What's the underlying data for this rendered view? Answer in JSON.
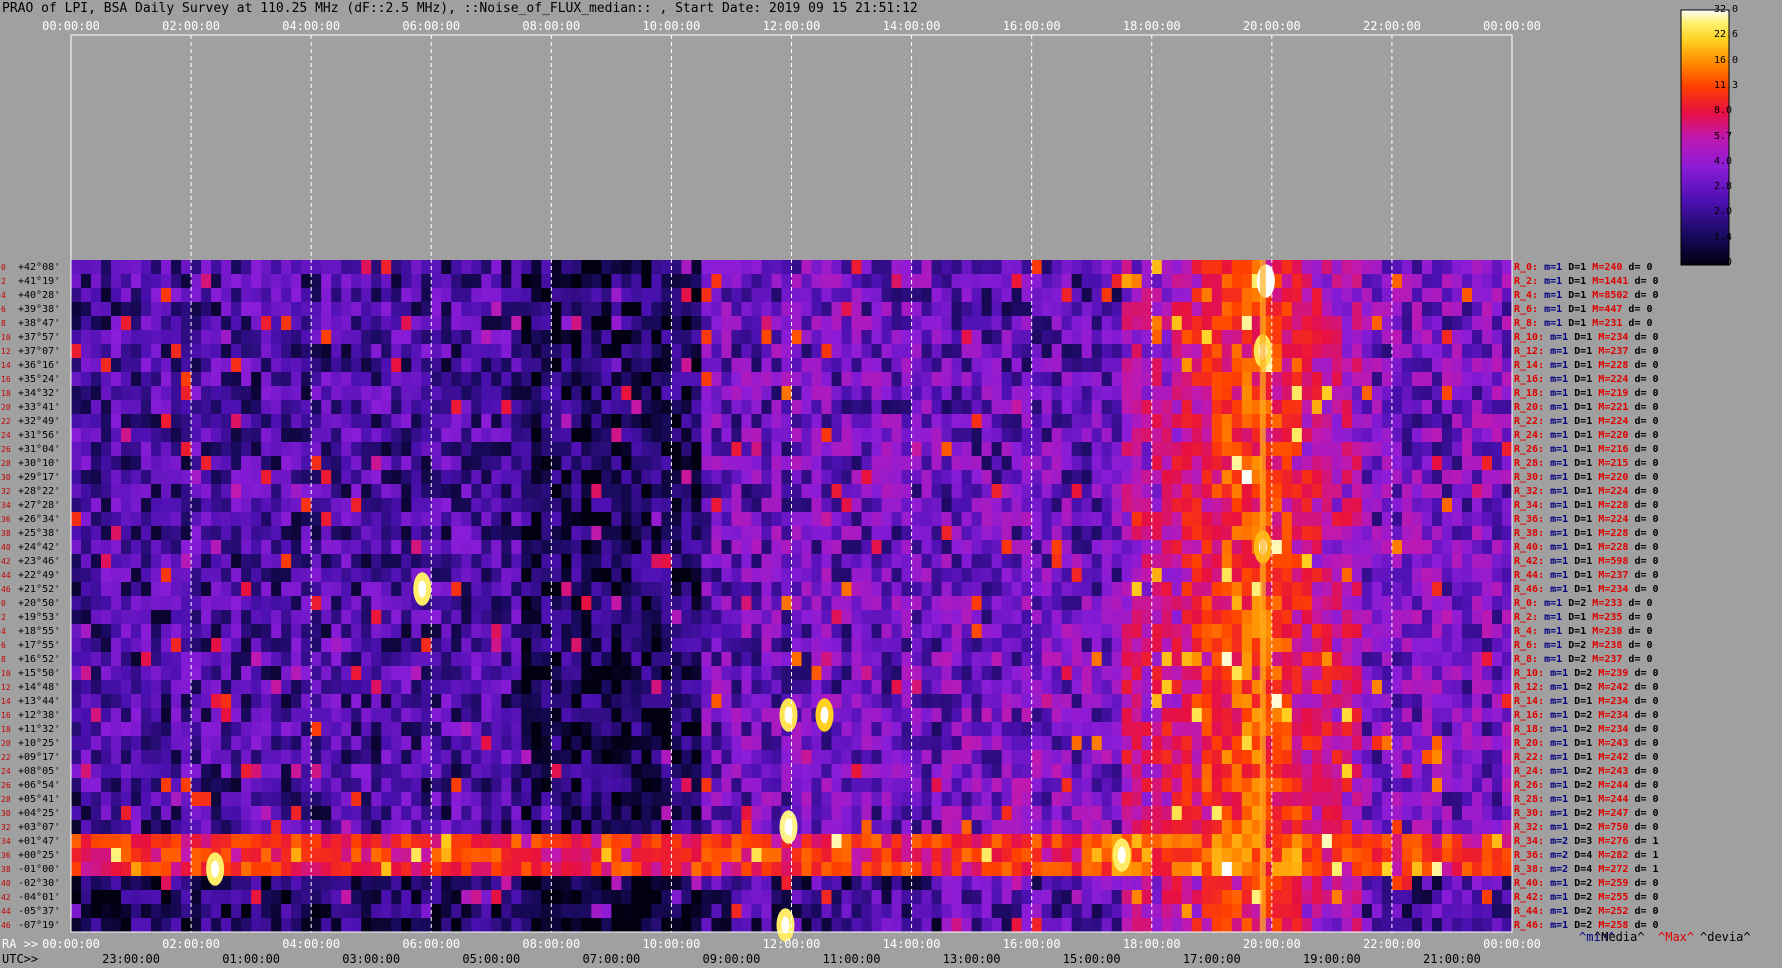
{
  "title": "PRAO of LPI, BSA Daily Survey at 110.25 MHz (dF::2.5 MHz), ::Noise_of_FLUX_median:: , Start Date: 2019 09 15 21:51:12",
  "axis": {
    "ra_prefix": "RA >>",
    "utc_prefix": "UTC>>",
    "top_ticks": [
      "00:00:00",
      "02:00:00",
      "04:00:00",
      "06:00:00",
      "08:00:00",
      "10:00:00",
      "12:00:00",
      "14:00:00",
      "16:00:00",
      "18:00:00",
      "20:00:00",
      "22:00:00",
      "00:00:00"
    ],
    "ra_ticks": [
      "00:00:00",
      "02:00:00",
      "04:00:00",
      "06:00:00",
      "08:00:00",
      "10:00:00",
      "12:00:00",
      "14:00:00",
      "16:00:00",
      "18:00:00",
      "20:00:00",
      "22:00:00",
      "00:00:00"
    ],
    "utc_ticks": [
      "23:00:00",
      "01:00:00",
      "03:00:00",
      "05:00:00",
      "07:00:00",
      "09:00:00",
      "11:00:00",
      "13:00:00",
      "15:00:00",
      "17:00:00",
      "19:00:00",
      "21:00:00"
    ]
  },
  "declinations": [
    "+42°08'",
    "+41°19'",
    "+40°28'",
    "+39°38'",
    "+38°47'",
    "+37°57'",
    "+37°07'",
    "+36°16'",
    "+35°24'",
    "+34°32'",
    "+33°41'",
    "+32°49'",
    "+31°56'",
    "+31°04'",
    "+30°10'",
    "+29°17'",
    "+28°22'",
    "+27°28'",
    "+26°34'",
    "+25°38'",
    "+24°42'",
    "+23°46'",
    "+22°49'",
    "+21°52'",
    "+20°50'",
    "+19°53'",
    "+18°55'",
    "+17°55'",
    "+16°52'",
    "+15°50'",
    "+14°48'",
    "+13°44'",
    "+12°38'",
    "+11°32'",
    "+10°25'",
    "+09°17'",
    "+08°05'",
    "+06°54'",
    "+05°41'",
    "+04°25'",
    "+03°07'",
    "+01°47'",
    "+00°25'",
    "-01°00'",
    "-02°30'",
    "-04°01'",
    "-05°37'",
    "-07°19'"
  ],
  "row_indices": [
    "0",
    "2",
    "4",
    "6",
    "8",
    "10",
    "12",
    "14",
    "16",
    "18",
    "20",
    "22",
    "24",
    "26",
    "28",
    "30",
    "32",
    "34",
    "36",
    "38",
    "40",
    "42",
    "44",
    "46",
    "0",
    "2",
    "4",
    "6",
    "8",
    "10",
    "12",
    "14",
    "16",
    "18",
    "20",
    "22",
    "24",
    "26",
    "28",
    "30",
    "32",
    "34",
    "36",
    "38",
    "40",
    "42",
    "44",
    "46"
  ],
  "stats": [
    {
      "r": "R_0:",
      "m": "m=1",
      "D": "D=1",
      "M": "M=240",
      "d": "d= 0"
    },
    {
      "r": "R_2:",
      "m": "m=1",
      "D": "D=1",
      "M": "M=1441",
      "d": "d= 0"
    },
    {
      "r": "R_4:",
      "m": "m=1",
      "D": "D=1",
      "M": "M=8502",
      "d": "d= 0"
    },
    {
      "r": "R_6:",
      "m": "m=1",
      "D": "D=1",
      "M": "M=447",
      "d": "d= 0"
    },
    {
      "r": "R_8:",
      "m": "m=1",
      "D": "D=1",
      "M": "M=231",
      "d": "d= 0"
    },
    {
      "r": "R_10:",
      "m": "m=1",
      "D": "D=1",
      "M": "M=234",
      "d": "d= 0"
    },
    {
      "r": "R_12:",
      "m": "m=1",
      "D": "D=1",
      "M": "M=237",
      "d": "d= 0"
    },
    {
      "r": "R_14:",
      "m": "m=1",
      "D": "D=1",
      "M": "M=228",
      "d": "d= 0"
    },
    {
      "r": "R_16:",
      "m": "m=1",
      "D": "D=1",
      "M": "M=224",
      "d": "d= 0"
    },
    {
      "r": "R_18:",
      "m": "m=1",
      "D": "D=1",
      "M": "M=219",
      "d": "d= 0"
    },
    {
      "r": "R_20:",
      "m": "m=1",
      "D": "D=1",
      "M": "M=221",
      "d": "d= 0"
    },
    {
      "r": "R_22:",
      "m": "m=1",
      "D": "D=1",
      "M": "M=224",
      "d": "d= 0"
    },
    {
      "r": "R_24:",
      "m": "m=1",
      "D": "D=1",
      "M": "M=220",
      "d": "d= 0"
    },
    {
      "r": "R_26:",
      "m": "m=1",
      "D": "D=1",
      "M": "M=216",
      "d": "d= 0"
    },
    {
      "r": "R_28:",
      "m": "m=1",
      "D": "D=1",
      "M": "M=215",
      "d": "d= 0"
    },
    {
      "r": "R_30:",
      "m": "m=1",
      "D": "D=1",
      "M": "M=220",
      "d": "d= 0"
    },
    {
      "r": "R_32:",
      "m": "m=1",
      "D": "D=1",
      "M": "M=224",
      "d": "d= 0"
    },
    {
      "r": "R_34:",
      "m": "m=1",
      "D": "D=1",
      "M": "M=228",
      "d": "d= 0"
    },
    {
      "r": "R_36:",
      "m": "m=1",
      "D": "D=1",
      "M": "M=224",
      "d": "d= 0"
    },
    {
      "r": "R_38:",
      "m": "m=1",
      "D": "D=1",
      "M": "M=228",
      "d": "d= 0"
    },
    {
      "r": "R_40:",
      "m": "m=1",
      "D": "D=1",
      "M": "M=228",
      "d": "d= 0"
    },
    {
      "r": "R_42:",
      "m": "m=1",
      "D": "D=1",
      "M": "M=598",
      "d": "d= 0"
    },
    {
      "r": "R_44:",
      "m": "m=1",
      "D": "D=1",
      "M": "M=237",
      "d": "d= 0"
    },
    {
      "r": "R_46:",
      "m": "m=1",
      "D": "D=1",
      "M": "M=234",
      "d": "d= 0"
    },
    {
      "r": "R_0:",
      "m": "m=1",
      "D": "D=2",
      "M": "M=233",
      "d": "d= 0"
    },
    {
      "r": "R_2:",
      "m": "m=1",
      "D": "D=1",
      "M": "M=235",
      "d": "d= 0"
    },
    {
      "r": "R_4:",
      "m": "m=1",
      "D": "D=1",
      "M": "M=238",
      "d": "d= 0"
    },
    {
      "r": "R_6:",
      "m": "m=1",
      "D": "D=2",
      "M": "M=238",
      "d": "d= 0"
    },
    {
      "r": "R_8:",
      "m": "m=1",
      "D": "D=2",
      "M": "M=237",
      "d": "d= 0"
    },
    {
      "r": "R_10:",
      "m": "m=1",
      "D": "D=2",
      "M": "M=239",
      "d": "d= 0"
    },
    {
      "r": "R_12:",
      "m": "m=1",
      "D": "D=2",
      "M": "M=242",
      "d": "d= 0"
    },
    {
      "r": "R_14:",
      "m": "m=1",
      "D": "D=1",
      "M": "M=234",
      "d": "d= 0"
    },
    {
      "r": "R_16:",
      "m": "m=1",
      "D": "D=2",
      "M": "M=234",
      "d": "d= 0"
    },
    {
      "r": "R_18:",
      "m": "m=1",
      "D": "D=2",
      "M": "M=234",
      "d": "d= 0"
    },
    {
      "r": "R_20:",
      "m": "m=1",
      "D": "D=1",
      "M": "M=243",
      "d": "d= 0"
    },
    {
      "r": "R_22:",
      "m": "m=1",
      "D": "D=1",
      "M": "M=242",
      "d": "d= 0"
    },
    {
      "r": "R_24:",
      "m": "m=1",
      "D": "D=2",
      "M": "M=243",
      "d": "d= 0"
    },
    {
      "r": "R_26:",
      "m": "m=1",
      "D": "D=2",
      "M": "M=244",
      "d": "d= 0"
    },
    {
      "r": "R_28:",
      "m": "m=1",
      "D": "D=1",
      "M": "M=244",
      "d": "d= 0"
    },
    {
      "r": "R_30:",
      "m": "m=1",
      "D": "D=2",
      "M": "M=247",
      "d": "d= 0"
    },
    {
      "r": "R_32:",
      "m": "m=1",
      "D": "D=2",
      "M": "M=750",
      "d": "d= 0"
    },
    {
      "r": "R_34:",
      "m": "m=2",
      "D": "D=3",
      "M": "M=276",
      "d": "d= 1"
    },
    {
      "r": "R_36:",
      "m": "m=2",
      "D": "D=4",
      "M": "M=282",
      "d": "d= 1"
    },
    {
      "r": "R_38:",
      "m": "m=2",
      "D": "D=4",
      "M": "M=272",
      "d": "d= 1"
    },
    {
      "r": "R_40:",
      "m": "m=1",
      "D": "D=2",
      "M": "M=259",
      "d": "d= 0"
    },
    {
      "r": "R_42:",
      "m": "m=1",
      "D": "D=2",
      "M": "M=255",
      "d": "d= 0"
    },
    {
      "r": "R_44:",
      "m": "m=1",
      "D": "D=2",
      "M": "M=252",
      "d": "d= 0"
    },
    {
      "r": "R_46:",
      "m": "m=1",
      "D": "D=2",
      "M": "M=258",
      "d": "d= 0"
    }
  ],
  "legend": {
    "min": "^min^",
    "median": "^Media^",
    "max": "^Max^",
    "dev": "^devia^"
  },
  "colorbar": {
    "ticks": [
      "32.0",
      "22.6",
      "16.0",
      "11.3",
      "8.0",
      "5.7",
      "4.0",
      "2.8",
      "2.0",
      "1.4",
      "1.0"
    ]
  },
  "chart_data": {
    "type": "heatmap",
    "title": "PRAO of LPI, BSA Daily Survey at 110.25 MHz (dF::2.5 MHz), ::Noise_of_FLUX_median:: , Start Date: 2019 09 15 21:51:12",
    "xlabel": "RA",
    "ylabel": "",
    "x_range": [
      "00:00:00",
      "00:00:00"
    ],
    "y_range": [
      "+42°08'",
      "-07°19'"
    ],
    "color_range": [
      1.0,
      32.0
    ],
    "colormap": [
      "#000010",
      "#1a0a60",
      "#4b10b0",
      "#8a1cd8",
      "#c018b0",
      "#e81040",
      "#ff4000",
      "#ff9000",
      "#ffd020",
      "#fff070",
      "#ffffff"
    ],
    "bright_features": [
      {
        "ra_hour": 19.9,
        "dec_row": 1,
        "intensity": 32
      },
      {
        "ra_hour": 19.85,
        "dec_row": 6,
        "intensity": 20
      },
      {
        "ra_hour": 19.85,
        "dec_row": 20,
        "intensity": 14
      },
      {
        "ra_hour": 5.85,
        "dec_row": 23,
        "intensity": 22
      },
      {
        "ra_hour": 11.95,
        "dec_row": 32,
        "intensity": 20
      },
      {
        "ra_hour": 12.55,
        "dec_row": 32,
        "intensity": 16
      },
      {
        "ra_hour": 11.95,
        "dec_row": 40,
        "intensity": 24
      },
      {
        "ra_hour": 17.5,
        "dec_row": 42,
        "intensity": 22
      },
      {
        "ra_hour": 2.4,
        "dec_row": 43,
        "intensity": 22
      },
      {
        "ra_hour": 11.9,
        "dec_row": 47,
        "intensity": 22
      }
    ]
  }
}
